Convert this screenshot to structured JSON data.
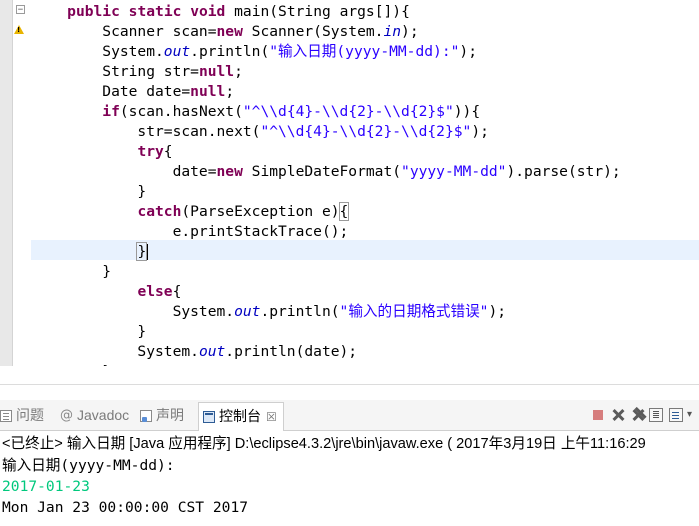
{
  "editor": {
    "lines": [
      [
        {
          "t": "    "
        },
        {
          "t": "public",
          "c": "kw"
        },
        {
          "t": " "
        },
        {
          "t": "static",
          "c": "kw"
        },
        {
          "t": " "
        },
        {
          "t": "void",
          "c": "kw"
        },
        {
          "t": " main(String args[]){"
        }
      ],
      [
        {
          "t": "        Scanner scan="
        },
        {
          "t": "new",
          "c": "kw"
        },
        {
          "t": " Scanner(System."
        },
        {
          "t": "in",
          "c": "fi"
        },
        {
          "t": ");"
        }
      ],
      [
        {
          "t": "        System."
        },
        {
          "t": "out",
          "c": "fi"
        },
        {
          "t": ".println("
        },
        {
          "t": "\"输入日期(yyyy-MM-dd):\"",
          "c": "st"
        },
        {
          "t": ");"
        }
      ],
      [
        {
          "t": "        String str="
        },
        {
          "t": "null",
          "c": "kw"
        },
        {
          "t": ";"
        }
      ],
      [
        {
          "t": "        Date date="
        },
        {
          "t": "null",
          "c": "kw"
        },
        {
          "t": ";"
        }
      ],
      [
        {
          "t": "        "
        },
        {
          "t": "if",
          "c": "kw"
        },
        {
          "t": "(scan.hasNext("
        },
        {
          "t": "\"^\\\\d{4}-\\\\d{2}-\\\\d{2}$\"",
          "c": "st"
        },
        {
          "t": ")){"
        }
      ],
      [
        {
          "t": "            str=scan.next("
        },
        {
          "t": "\"^\\\\d{4}-\\\\d{2}-\\\\d{2}$\"",
          "c": "st"
        },
        {
          "t": ");"
        }
      ],
      [
        {
          "t": "            "
        },
        {
          "t": "try",
          "c": "kw"
        },
        {
          "t": "{"
        }
      ],
      [
        {
          "t": "                date="
        },
        {
          "t": "new",
          "c": "kw"
        },
        {
          "t": " SimpleDateFormat("
        },
        {
          "t": "\"yyyy-MM-dd\"",
          "c": "st"
        },
        {
          "t": ").parse(str);"
        }
      ],
      [
        {
          "t": "            }"
        }
      ],
      [
        {
          "t": "            "
        },
        {
          "t": "catch",
          "c": "kw"
        },
        {
          "t": "(ParseException e)"
        },
        {
          "t": "{",
          "c": "brace"
        }
      ],
      [
        {
          "t": "                e.printStackTrace();"
        }
      ],
      [
        {
          "t": "            "
        },
        {
          "t": "}",
          "c": "brace"
        },
        {
          "t": "",
          "c": "caret"
        }
      ],
      [
        {
          "t": "        }"
        }
      ],
      [
        {
          "t": "            "
        },
        {
          "t": "else",
          "c": "kw"
        },
        {
          "t": "{"
        }
      ],
      [
        {
          "t": "                System."
        },
        {
          "t": "out",
          "c": "fi"
        },
        {
          "t": ".println("
        },
        {
          "t": "\"输入的日期格式错误\"",
          "c": "st"
        },
        {
          "t": ");"
        }
      ],
      [
        {
          "t": "            }"
        }
      ],
      [
        {
          "t": "            System."
        },
        {
          "t": "out",
          "c": "fi"
        },
        {
          "t": ".println(date);"
        }
      ],
      [
        {
          "t": "        }"
        }
      ]
    ],
    "markers": {
      "fold_line": 0,
      "warning_line": 1
    },
    "colors": {
      "keyword": "#7f0055",
      "string": "#2a00ff",
      "field": "#0000c0",
      "current_line": "#e8f2fe"
    }
  },
  "console": {
    "tabs": [
      {
        "label": "问题",
        "icon": "problems-icon"
      },
      {
        "label": "Javadoc",
        "icon": "at-icon"
      },
      {
        "label": "声明",
        "icon": "declaration-icon"
      },
      {
        "label": "控制台",
        "icon": "console-icon",
        "close": "☒"
      }
    ],
    "toolbar_icons": [
      "terminate-icon",
      "remove-launch-icon",
      "remove-all-icon",
      "scroll-lock-icon",
      "word-wrap-icon",
      "pin-icon"
    ],
    "status": "<已终止> 输入日期 [Java 应用程序] D:\\eclipse4.3.2\\jre\\bin\\javaw.exe ( 2017年3月19日 上午11:16:29",
    "output": [
      "输入日期(yyyy-MM-dd):",
      "2017-01-23",
      "Mon Jan 23 00:00:00 CST 2017"
    ],
    "colors": {
      "user_input": "#00c87d"
    }
  }
}
